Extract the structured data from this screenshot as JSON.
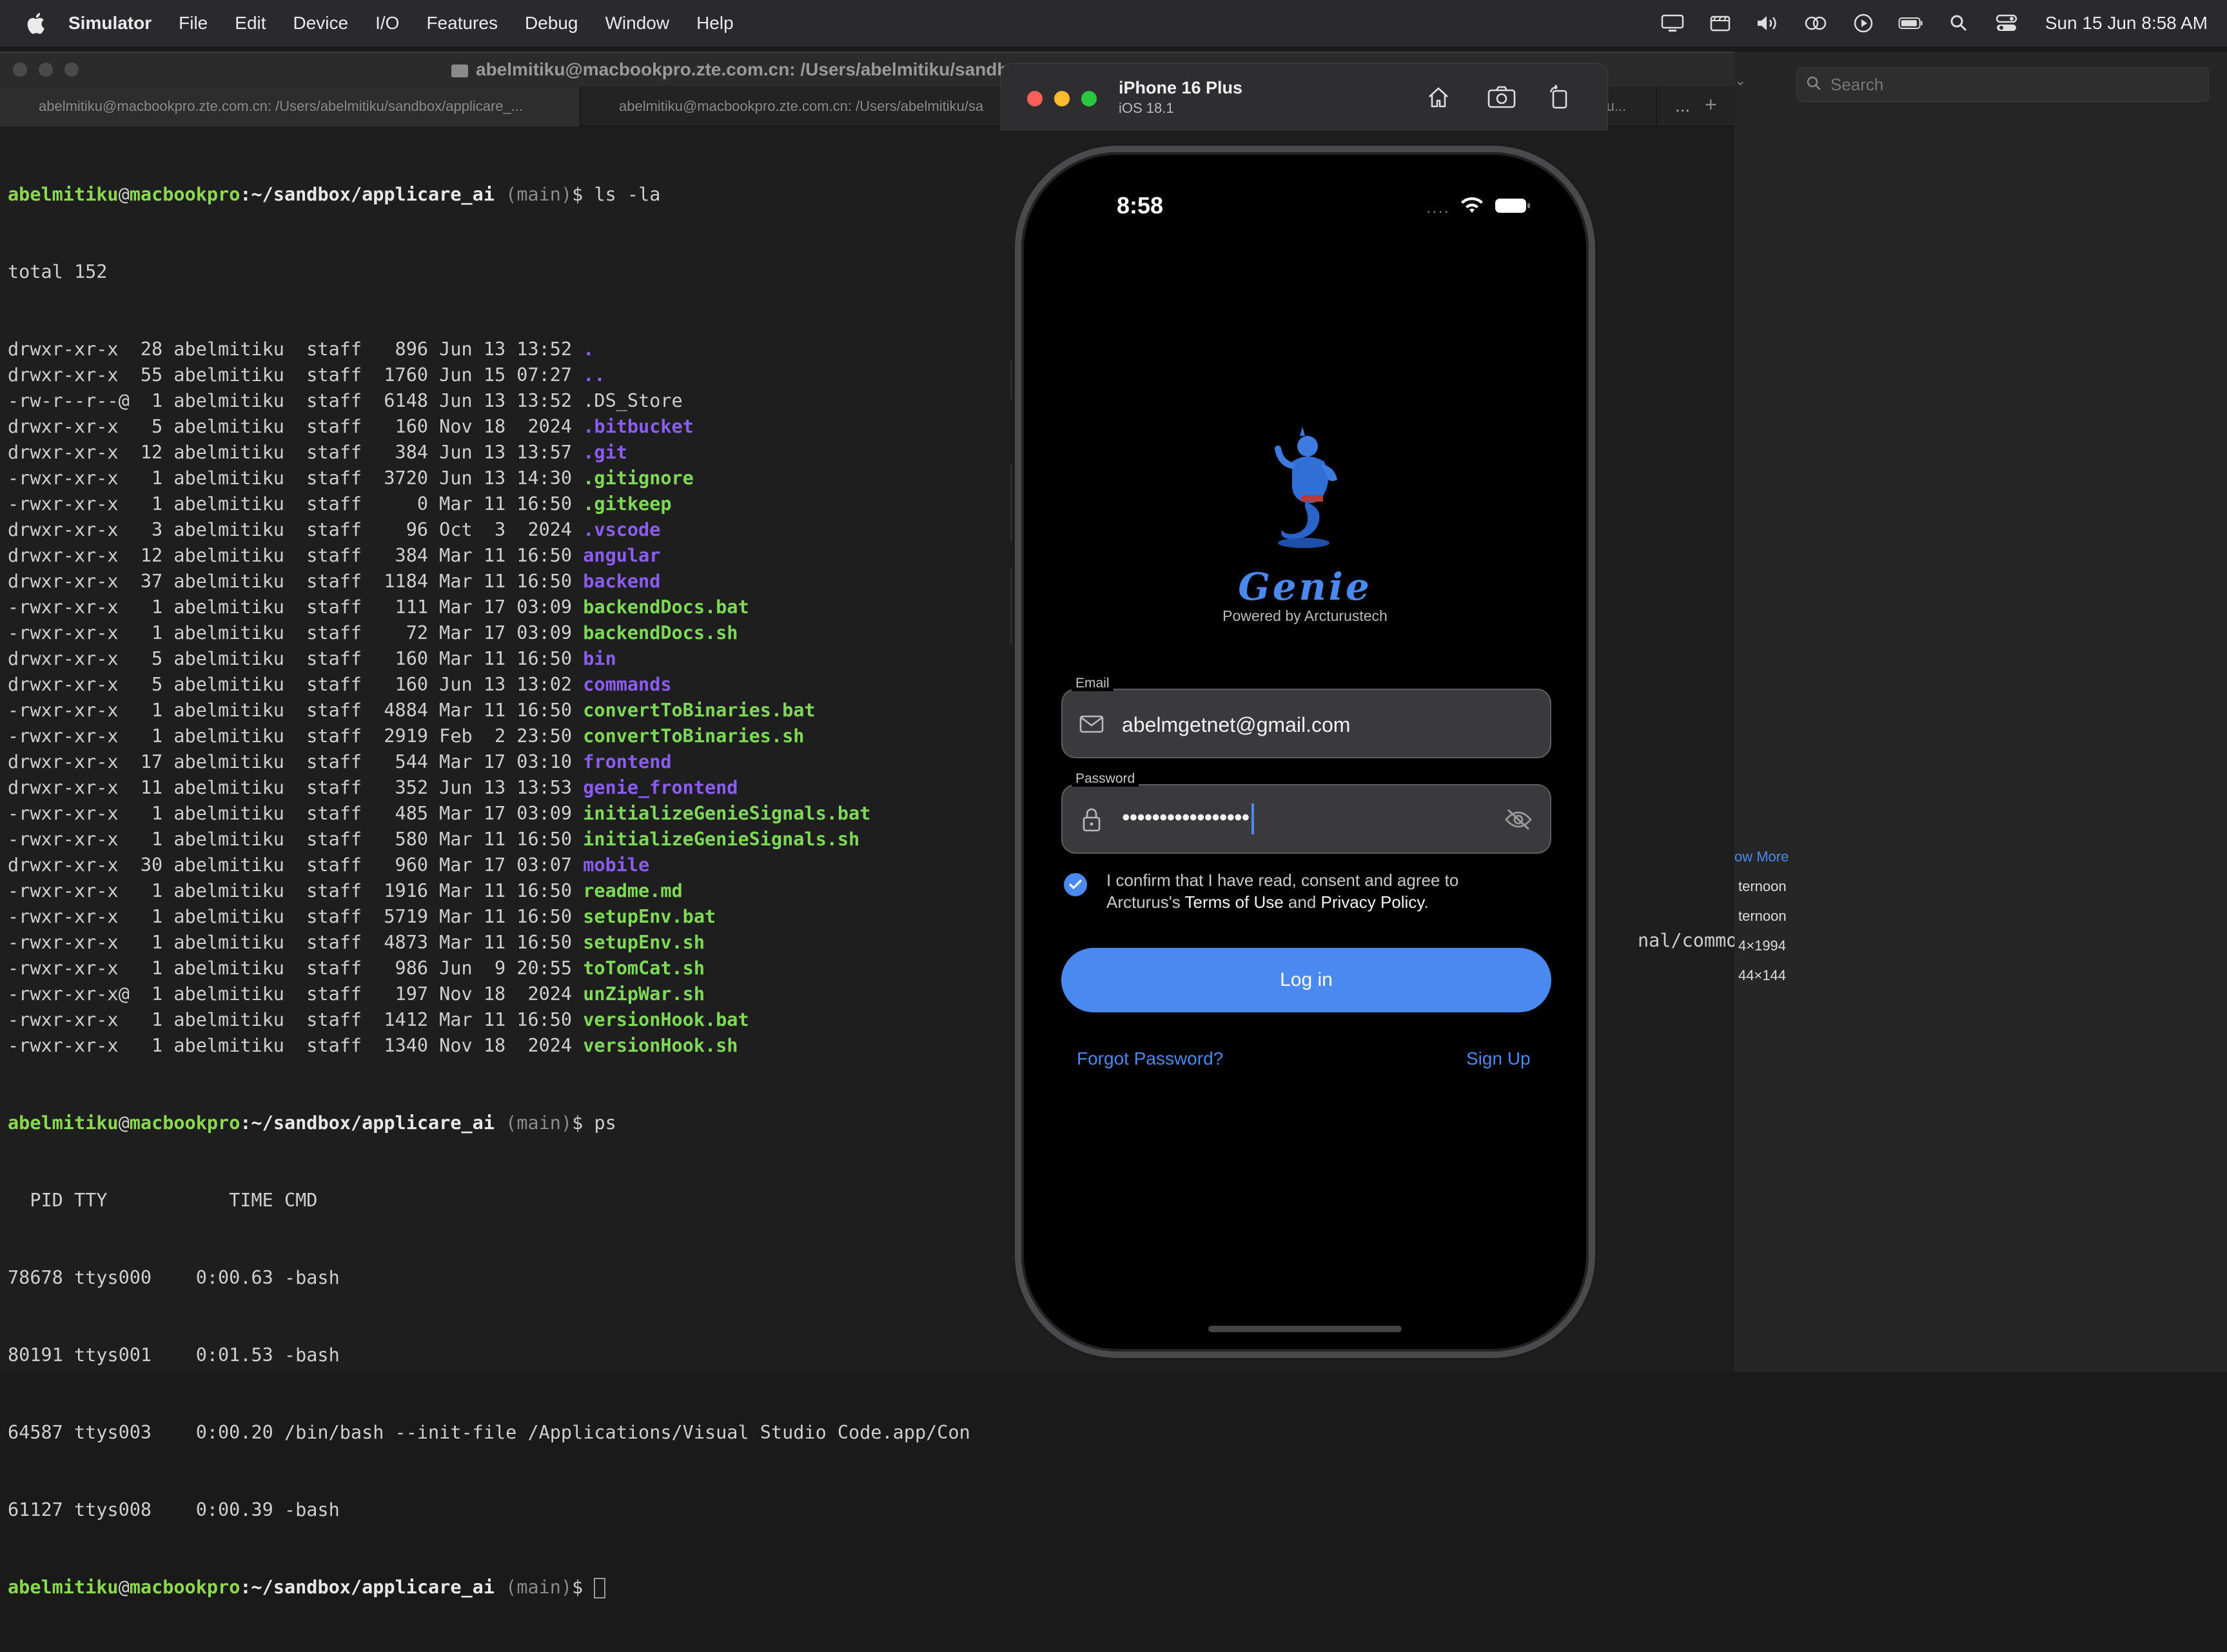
{
  "menubar": {
    "app_name": "Simulator",
    "items": [
      "File",
      "Edit",
      "Device",
      "I/O",
      "Features",
      "Debug",
      "Window",
      "Help"
    ],
    "clock": "Sun 15 Jun  8:58 AM"
  },
  "terminal": {
    "window_title": "abelmitiku@macbookpro.zte.com.cn: /Users/abelmitiku/sandbo",
    "tabs": [
      "abelmitiku@macbookpro.zte.com.cn: /Users/abelmitiku/sandbox/applicare_...",
      "abelmitiku@macbookpro.zte.com.cn: /Users/abelmitiku/sa",
      "/githu..."
    ],
    "tab_more": "...",
    "tab_add": "+",
    "prompt": {
      "user": "abelmitiku",
      "at": "@",
      "host": "macbookpro",
      "path": ":~/sandbox/applicare_ai",
      "branch": " (main)",
      "dollar": "$ "
    },
    "command1": "ls -la",
    "total": "total 152",
    "listing": [
      {
        "meta": "drwxr-xr-x  28 abelmitiku  staff   896 Jun 13 13:52 ",
        "name": ".",
        "kind": "dir"
      },
      {
        "meta": "drwxr-xr-x  55 abelmitiku  staff  1760 Jun 15 07:27 ",
        "name": "..",
        "kind": "dir"
      },
      {
        "meta": "-rw-r--r--@  1 abelmitiku  staff  6148 Jun 13 13:52 ",
        "name": ".DS_Store",
        "kind": "file"
      },
      {
        "meta": "drwxr-xr-x   5 abelmitiku  staff   160 Nov 18  2024 ",
        "name": ".bitbucket",
        "kind": "dir"
      },
      {
        "meta": "drwxr-xr-x  12 abelmitiku  staff   384 Jun 13 13:57 ",
        "name": ".git",
        "kind": "dir"
      },
      {
        "meta": "-rwxr-xr-x   1 abelmitiku  staff  3720 Jun 13 14:30 ",
        "name": ".gitignore",
        "kind": "exec"
      },
      {
        "meta": "-rwxr-xr-x   1 abelmitiku  staff     0 Mar 11 16:50 ",
        "name": ".gitkeep",
        "kind": "exec"
      },
      {
        "meta": "drwxr-xr-x   3 abelmitiku  staff    96 Oct  3  2024 ",
        "name": ".vscode",
        "kind": "dir"
      },
      {
        "meta": "drwxr-xr-x  12 abelmitiku  staff   384 Mar 11 16:50 ",
        "name": "angular",
        "kind": "dir"
      },
      {
        "meta": "drwxr-xr-x  37 abelmitiku  staff  1184 Mar 11 16:50 ",
        "name": "backend",
        "kind": "dir"
      },
      {
        "meta": "-rwxr-xr-x   1 abelmitiku  staff   111 Mar 17 03:09 ",
        "name": "backendDocs.bat",
        "kind": "exec"
      },
      {
        "meta": "-rwxr-xr-x   1 abelmitiku  staff    72 Mar 17 03:09 ",
        "name": "backendDocs.sh",
        "kind": "exec"
      },
      {
        "meta": "drwxr-xr-x   5 abelmitiku  staff   160 Mar 11 16:50 ",
        "name": "bin",
        "kind": "dir"
      },
      {
        "meta": "drwxr-xr-x   5 abelmitiku  staff   160 Jun 13 13:02 ",
        "name": "commands",
        "kind": "dir"
      },
      {
        "meta": "-rwxr-xr-x   1 abelmitiku  staff  4884 Mar 11 16:50 ",
        "name": "convertToBinaries.bat",
        "kind": "exec"
      },
      {
        "meta": "-rwxr-xr-x   1 abelmitiku  staff  2919 Feb  2 23:50 ",
        "name": "convertToBinaries.sh",
        "kind": "exec"
      },
      {
        "meta": "drwxr-xr-x  17 abelmitiku  staff   544 Mar 17 03:10 ",
        "name": "frontend",
        "kind": "dir"
      },
      {
        "meta": "drwxr-xr-x  11 abelmitiku  staff   352 Jun 13 13:53 ",
        "name": "genie_frontend",
        "kind": "dir"
      },
      {
        "meta": "-rwxr-xr-x   1 abelmitiku  staff   485 Mar 17 03:09 ",
        "name": "initializeGenieSignals.bat",
        "kind": "exec"
      },
      {
        "meta": "-rwxr-xr-x   1 abelmitiku  staff   580 Mar 11 16:50 ",
        "name": "initializeGenieSignals.sh",
        "kind": "exec"
      },
      {
        "meta": "drwxr-xr-x  30 abelmitiku  staff   960 Mar 17 03:07 ",
        "name": "mobile",
        "kind": "dir"
      },
      {
        "meta": "-rwxr-xr-x   1 abelmitiku  staff  1916 Mar 11 16:50 ",
        "name": "readme.md",
        "kind": "exec"
      },
      {
        "meta": "-rwxr-xr-x   1 abelmitiku  staff  5719 Mar 11 16:50 ",
        "name": "setupEnv.bat",
        "kind": "exec"
      },
      {
        "meta": "-rwxr-xr-x   1 abelmitiku  staff  4873 Mar 11 16:50 ",
        "name": "setupEnv.sh",
        "kind": "exec"
      },
      {
        "meta": "-rwxr-xr-x   1 abelmitiku  staff   986 Jun  9 20:55 ",
        "name": "toTomCat.sh",
        "kind": "exec"
      },
      {
        "meta": "-rwxr-xr-x@  1 abelmitiku  staff   197 Nov 18  2024 ",
        "name": "unZipWar.sh",
        "kind": "exec"
      },
      {
        "meta": "-rwxr-xr-x   1 abelmitiku  staff  1412 Mar 11 16:50 ",
        "name": "versionHook.bat",
        "kind": "exec"
      },
      {
        "meta": "-rwxr-xr-x   1 abelmitiku  staff  1340 Nov 18  2024 ",
        "name": "versionHook.sh",
        "kind": "exec"
      }
    ],
    "command2": "ps",
    "ps_header": "  PID TTY           TIME CMD",
    "ps_rows": [
      "78678 ttys000    0:00.63 -bash",
      "80191 ttys001    0:01.53 -bash",
      "64587 ttys003    0:00.20 /bin/bash --init-file /Applications/Visual Studio Code.app/Con",
      "61127 ttys008    0:00.39 -bash"
    ],
    "ps_row3_tail": "nal/common"
  },
  "background_window": {
    "search_placeholder": "Search",
    "texts": [
      "ow More",
      "ternoon",
      "ternoon",
      "4×1994",
      "44×144"
    ]
  },
  "simulator": {
    "device_name": "iPhone 16 Plus",
    "os_version": "iOS 18.1"
  },
  "app": {
    "status_time": "8:58",
    "status_dots": "....",
    "title": "Genie",
    "subtitle": "Powered by Arcturustech",
    "email_label": "Email",
    "email_value": "abelmgetnet@gmail.com",
    "password_label": "Password",
    "password_dots": "•••••••••••••••••",
    "consent_pre": "I confirm that I have read, consent and agree to Arcturus's ",
    "terms": "Terms of Use",
    "consent_and": " and ",
    "privacy": "Privacy Policy",
    "consent_end": ".",
    "login": "Log in",
    "forgot": "Forgot Password?",
    "signup": "Sign Up"
  },
  "colors": {
    "accent": "#4a8af0",
    "term_user": "#8ad94e",
    "term_dir": "#8b5cf6",
    "term_exec": "#7ed957"
  }
}
